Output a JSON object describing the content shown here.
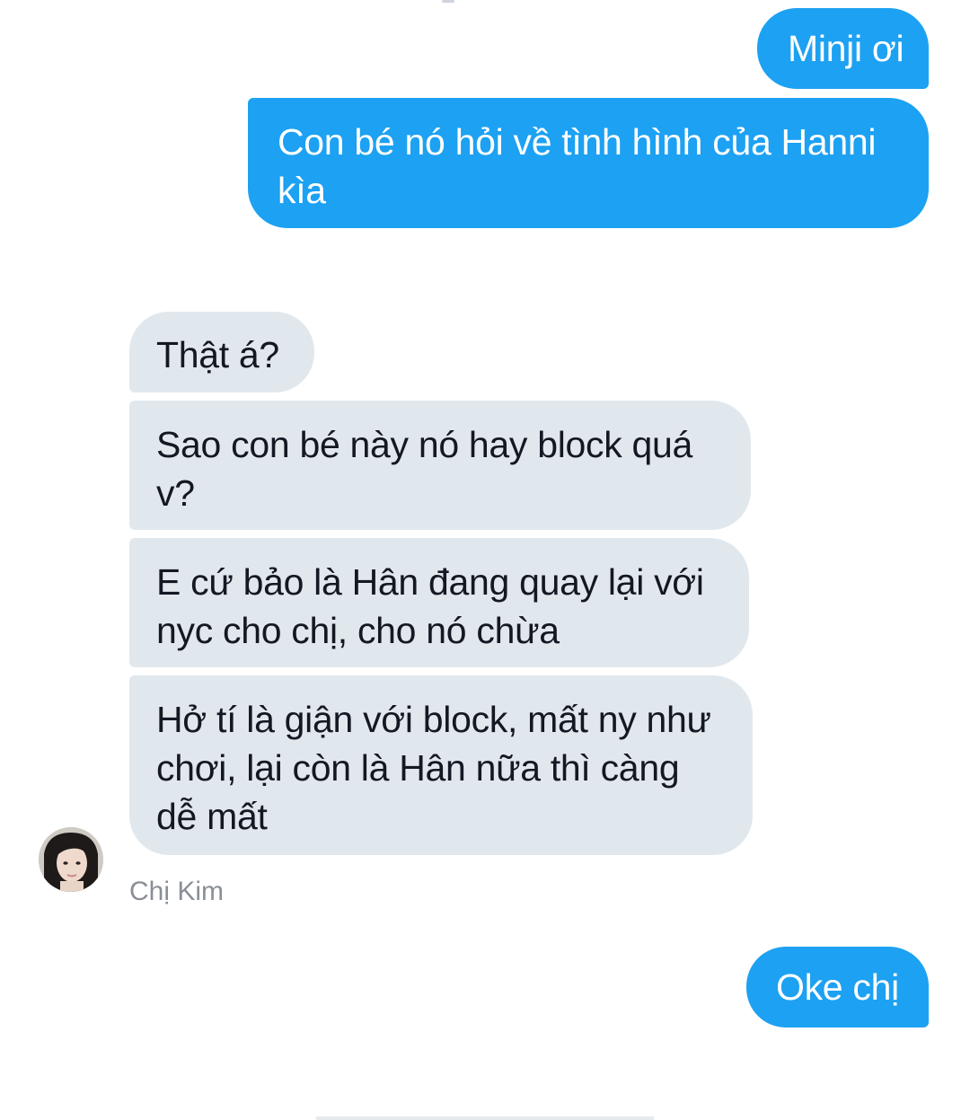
{
  "conversation": {
    "outgoing_1": {
      "text": "Minji ơi"
    },
    "outgoing_2": {
      "text": "Con bé nó hỏi về tình hình của Hanni kìa"
    },
    "incoming_1": {
      "text": "Thật á?"
    },
    "incoming_2": {
      "text": "Sao con bé này nó hay block quá v?"
    },
    "incoming_3": {
      "text": "E cứ bảo là Hân đang quay lại với nyc cho chị, cho nó chừa"
    },
    "incoming_4": {
      "text": "Hở tí là giận với block, mất ny như chơi, lại còn là Hân nữa thì càng dễ mất"
    },
    "sender": {
      "name": "Chị Kim"
    },
    "outgoing_3": {
      "text": "Oke chị"
    }
  },
  "colors": {
    "outgoing_bubble": "#1da1f2",
    "incoming_bubble": "#e1e8ed",
    "incoming_text": "#141823",
    "sender_name": "#8a8f96"
  },
  "icons": {
    "avatar": "user-avatar-photo"
  }
}
